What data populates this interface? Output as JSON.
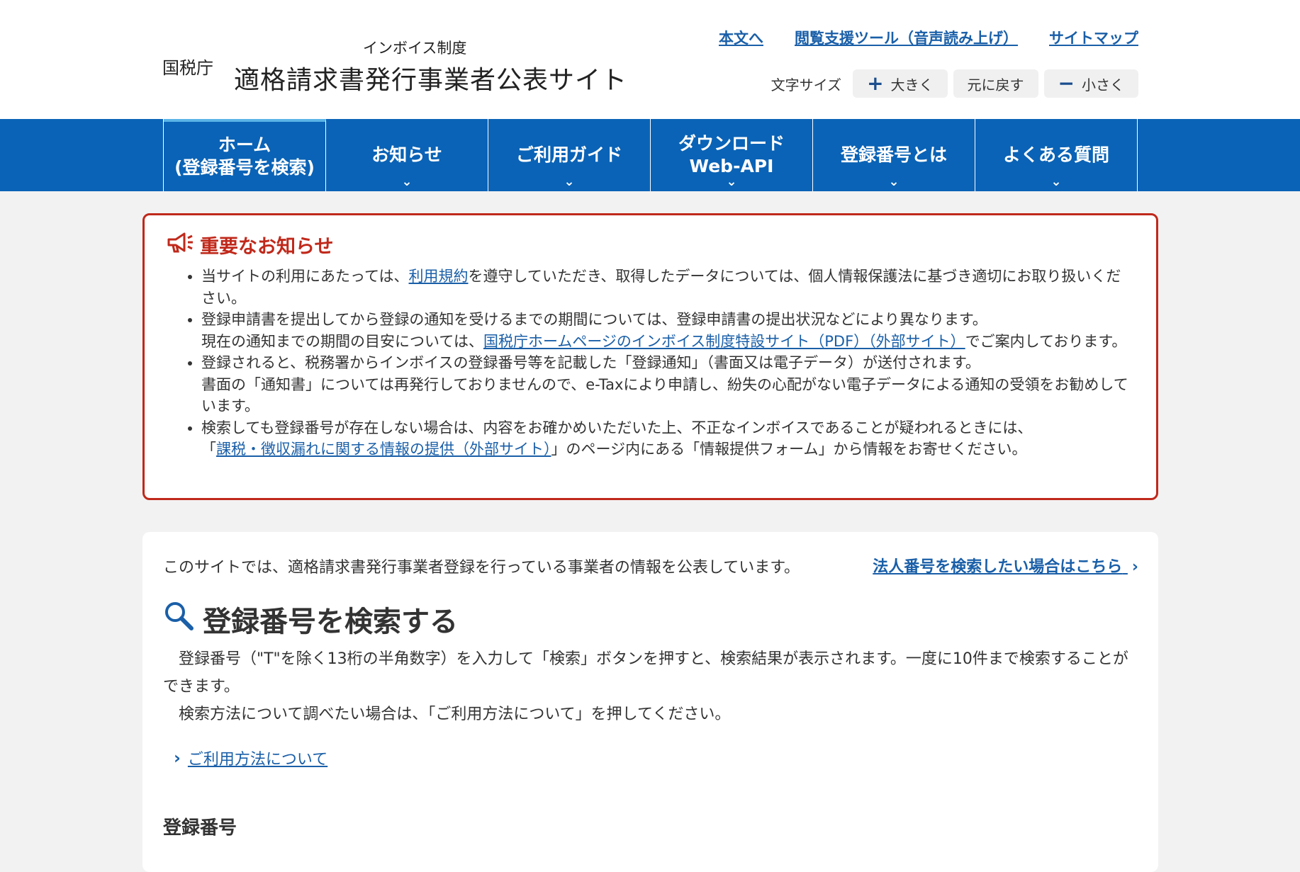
{
  "header": {
    "agency": "国税庁",
    "subtitle": "インボイス制度",
    "title": "適格請求書発行事業者公表サイト",
    "links": [
      "本文へ",
      "閲覧支援ツール（音声読み上げ）",
      "サイトマップ"
    ],
    "font_size": {
      "label": "文字サイズ",
      "larger": "大きく",
      "reset": "元に戻す",
      "smaller": "小さく"
    }
  },
  "nav": {
    "items": [
      {
        "line1": "ホーム",
        "line2": "(登録番号を検索)"
      },
      {
        "line1": "お知らせ",
        "line2": ""
      },
      {
        "line1": "ご利用ガイド",
        "line2": ""
      },
      {
        "line1": "ダウンロード",
        "line2": "Web-API"
      },
      {
        "line1": "登録番号とは",
        "line2": ""
      },
      {
        "line1": "よくある質問",
        "line2": ""
      }
    ]
  },
  "notice": {
    "title": "重要なお知らせ",
    "item1_pre": "当サイトの利用にあたっては、",
    "item1_link": "利用規約",
    "item1_post": "を遵守していただき、取得したデータについては、個人情報保護法に基づき適切にお取り扱いください。",
    "item2_line1": "登録申請書を提出してから登録の通知を受けるまでの期間については、登録申請書の提出状況などにより異なります。",
    "item2_pre": "現在の通知までの期間の目安については、",
    "item2_link": "国税庁ホームページのインボイス制度特設サイト（PDF）（外部サイト）",
    "item2_post": "でご案内しております。",
    "item3_line1": "登録されると、税務署からインボイスの登録番号等を記載した「登録通知」（書面又は電子データ）が送付されます。",
    "item3_line2": "書面の「通知書」については再発行しておりませんので、e-Taxにより申請し、紛失の心配がない電子データによる通知の受領をお勧めしています。",
    "item4_line1": "検索しても登録番号が存在しない場合は、内容をお確かめいただいた上、不正なインボイスであることが疑われるときには、",
    "item4_open": "「",
    "item4_link": "課税・徴収漏れに関する情報の提供（外部サイト）",
    "item4_post": "」のページ内にある「情報提供フォーム」から情報をお寄せください。"
  },
  "main": {
    "intro": "このサイトでは、適格請求書発行事業者登録を行っている事業者の情報を公表しています。",
    "corp_link": "法人番号を検索したい場合はこちら",
    "search_title": "登録番号を検索する",
    "desc1": "登録番号（\"T\"を除く13桁の半角数字）を入力して「検索」ボタンを押すと、検索結果が表示されます。一度に10件まで検索することができます。",
    "desc2": "検索方法について調べたい場合は、「ご利用方法について」を押してください。",
    "usage_link": "ご利用方法について",
    "reg_label": "登録番号"
  }
}
